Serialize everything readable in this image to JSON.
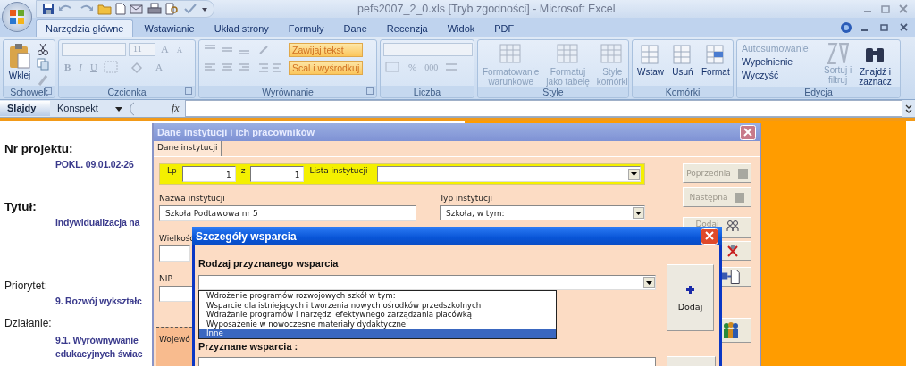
{
  "window": {
    "title": "pefs2007_2_0.xls  [Tryb zgodności] - Microsoft Excel"
  },
  "ribbon_tabs": [
    {
      "label": "Narzędzia główne",
      "selected": true
    },
    {
      "label": "Wstawianie",
      "selected": false
    },
    {
      "label": "Układ strony",
      "selected": false
    },
    {
      "label": "Formuły",
      "selected": false
    },
    {
      "label": "Dane",
      "selected": false
    },
    {
      "label": "Recenzja",
      "selected": false
    },
    {
      "label": "Widok",
      "selected": false
    },
    {
      "label": "PDF",
      "selected": false
    }
  ],
  "ribbon": {
    "clipboard": {
      "label": "Schowek",
      "paste": "Wklej"
    },
    "font": {
      "label": "Czcionka",
      "size": "11",
      "grow": "A",
      "shrink": "A",
      "bold": "B",
      "italic": "I",
      "underline": "U",
      "font_color": "A"
    },
    "alignment": {
      "label": "Wyrównanie",
      "wrap": "Zawijaj tekst",
      "merge": "Scal i wyśrodkuj"
    },
    "number": {
      "label": "Liczba",
      "percent": "%",
      "thousands": "000"
    },
    "styles": {
      "label": "Style",
      "items": [
        {
          "label": "Formatowanie\nwarunkowe",
          "disabled": true
        },
        {
          "label": "Formatuj\njako tabelę",
          "disabled": true
        },
        {
          "label": "Style\nkomórki",
          "disabled": true
        }
      ]
    },
    "cells": {
      "label": "Komórki",
      "items": [
        {
          "label": "Wstaw",
          "disabled": false
        },
        {
          "label": "Usuń",
          "disabled": false
        },
        {
          "label": "Format",
          "disabled": false
        }
      ]
    },
    "editing": {
      "label": "Edycja",
      "small": [
        {
          "label": "Autosumowanie",
          "disabled": true
        },
        {
          "label": "Wypełnienie",
          "disabled": false
        },
        {
          "label": "Wyczyść",
          "disabled": false
        }
      ],
      "large": [
        {
          "label": "Sortuj i\nfiltruj",
          "disabled": true
        },
        {
          "label": "Znajdź i\nzaznacz",
          "disabled": false
        }
      ]
    }
  },
  "sheet_tabs": [
    {
      "label": "Slajdy",
      "selected": true
    },
    {
      "label": "Konspekt",
      "selected": false
    }
  ],
  "formula_bar": {
    "fx": "fx"
  },
  "sheet": [
    {
      "kind": "heading",
      "text": "Nr projektu:"
    },
    {
      "kind": "value",
      "text": "POKL. 09.01.02-26"
    },
    {
      "kind": "heading",
      "text": "Tytuł:"
    },
    {
      "kind": "value",
      "text": "Indywidualizacja na"
    },
    {
      "kind": "label",
      "text": "Priorytet:"
    },
    {
      "kind": "value",
      "text": "9. Rozwój wykształc"
    },
    {
      "kind": "label",
      "text": "Działanie:"
    },
    {
      "kind": "value",
      "text": "9.1. Wyrównywanie"
    },
    {
      "kind": "value",
      "text": "edukacyjnych świac"
    }
  ],
  "institution_dialog": {
    "title": "Dane instytucji i ich pracowników",
    "tab": {
      "label": "Dane instytucji",
      "selected": true
    },
    "lp_label": "Lp",
    "lp_value": "1",
    "of_label": "z",
    "of_value": "1",
    "list_label": "Lista instytucji",
    "name_label": "Nazwa instytucji",
    "name_value": "Szkoła Podtawowa nr 5",
    "type_label": "Typ instytucji",
    "type_value": "Szkoła, w tym:",
    "size_label": "Wielkość",
    "nip_label": "NIP",
    "group_label": "Wojewó",
    "buttons": [
      {
        "kind": "text",
        "label": "Poprzednia",
        "disabled": true
      },
      {
        "kind": "text",
        "label": "Następna",
        "disabled": true
      },
      {
        "kind": "add",
        "label": "Dodaj",
        "disabled": true
      },
      {
        "kind": "delete"
      },
      {
        "kind": "export"
      },
      {
        "kind": "people"
      }
    ]
  },
  "support_dialog": {
    "title": "Szczegóły wsparcia",
    "type_label": "Rodzaj przyznanego wsparcia",
    "options": [
      {
        "label": "Wdrożenie programów rozwojowych szkół w tym:",
        "selected": false
      },
      {
        "label": "Wsparcie dla istniejących i tworzenia nowych ośrodków przedszkolnych",
        "selected": false
      },
      {
        "label": "Wdrażanie programów i narzędzi efektywnego zarządzania placówką",
        "selected": false
      },
      {
        "label": "Wyposażenie  w nowoczesne materiały dydaktyczne",
        "selected": false
      },
      {
        "label": "Inne",
        "selected": true
      }
    ],
    "add_button": "Dodaj",
    "granted_label": "Przyznane wsparcia :"
  }
}
